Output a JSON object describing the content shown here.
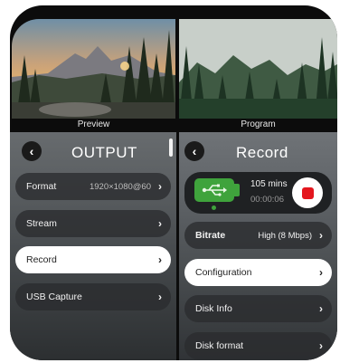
{
  "preview": {
    "caption": "Preview"
  },
  "program": {
    "caption": "Program"
  },
  "output_panel": {
    "back_icon": "chevron-left-icon",
    "title": "OUTPUT",
    "items": [
      {
        "label": "Format",
        "value": "1920×1080@60",
        "active": false
      },
      {
        "label": "Stream",
        "value": "",
        "active": false
      },
      {
        "label": "Record",
        "value": "",
        "active": true
      },
      {
        "label": "USB Capture",
        "value": "",
        "active": false
      }
    ]
  },
  "record_panel": {
    "back_icon": "chevron-left-icon",
    "title": "Record",
    "status": {
      "icon": "usb-drive-icon",
      "remaining": "105 mins",
      "elapsed": "00:00:06",
      "record_button_icon": "stop-record-icon",
      "accent_color": "#3fa33c",
      "record_color": "#e4161e"
    },
    "items": [
      {
        "label": "Bitrate",
        "value": "High  (8 Mbps)",
        "active": false
      },
      {
        "label": "Configuration",
        "value": "",
        "active": true
      },
      {
        "label": "Disk Info",
        "value": "",
        "active": false
      },
      {
        "label": "Disk format",
        "value": "",
        "active": false
      }
    ]
  }
}
